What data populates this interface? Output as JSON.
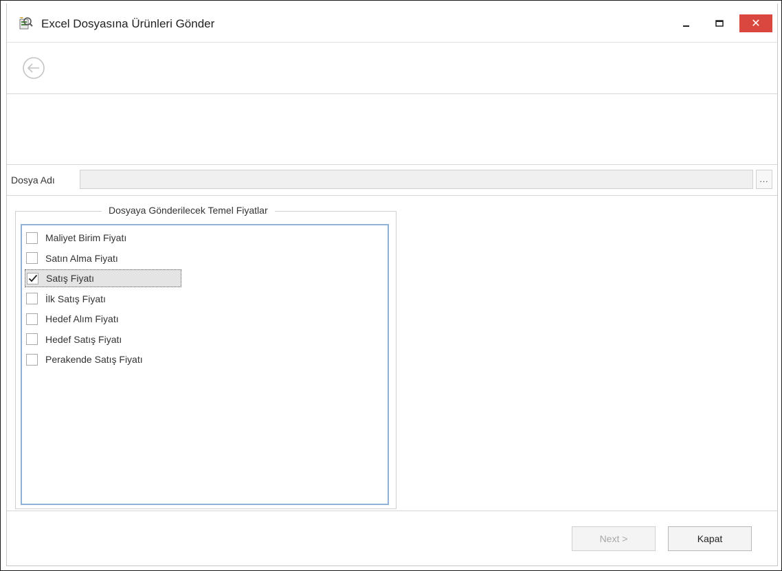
{
  "window": {
    "title": "Excel Dosyasına Ürünleri Gönder",
    "close_glyph": "✕"
  },
  "icons": {
    "app": "excel-export-icon",
    "back": "back-arrow-icon",
    "minimize": "minimize-icon",
    "maximize": "maximize-icon",
    "close": "close-icon",
    "check": "checkmark-icon"
  },
  "file": {
    "label": "Dosya Adı",
    "value": "",
    "browse_label": "..."
  },
  "group": {
    "title": "Dosyaya Gönderilecek Temel Fiyatlar",
    "items": [
      {
        "label": "Maliyet Birim Fiyatı",
        "checked": false,
        "selected": false
      },
      {
        "label": "Satın Alma Fiyatı",
        "checked": false,
        "selected": false
      },
      {
        "label": "Satış Fiyatı",
        "checked": true,
        "selected": true
      },
      {
        "label": "İlk Satış Fiyatı",
        "checked": false,
        "selected": false
      },
      {
        "label": "Hedef Alım Fiyatı",
        "checked": false,
        "selected": false
      },
      {
        "label": "Hedef Satış Fiyatı",
        "checked": false,
        "selected": false
      },
      {
        "label": "Perakende Satış Fiyatı",
        "checked": false,
        "selected": false
      }
    ]
  },
  "footer": {
    "next_label": "Next >",
    "next_enabled": false,
    "close_label": "Kapat"
  },
  "colors": {
    "close_button": "#d9473e",
    "list_border": "#8fb2d6",
    "disabled_text": "#a8a8a8"
  }
}
